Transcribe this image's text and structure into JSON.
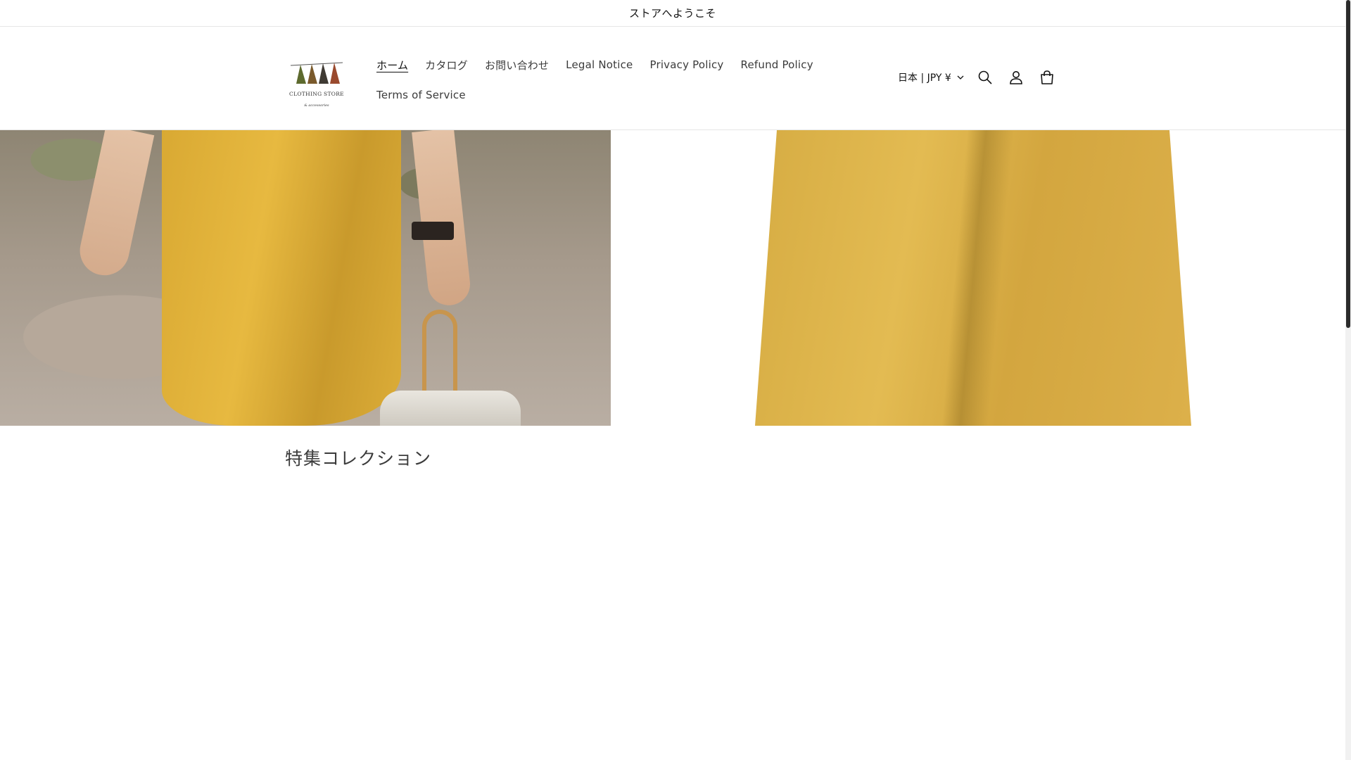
{
  "announcement": {
    "text": "ストアへようこそ"
  },
  "header": {
    "logo": {
      "text": "CLOTHING STORE",
      "sub": "& accessories"
    },
    "nav": [
      {
        "label": "ホーム",
        "active": true
      },
      {
        "label": "カタログ",
        "active": false
      },
      {
        "label": "お問い合わせ",
        "active": false
      },
      {
        "label": "Legal Notice",
        "active": false
      },
      {
        "label": "Privacy Policy",
        "active": false
      },
      {
        "label": "Refund Policy",
        "active": false
      },
      {
        "label": "Terms of Service",
        "active": false
      }
    ],
    "locale": "日本 | JPY ¥",
    "icons": [
      "search-icon",
      "account-icon",
      "cart-icon"
    ]
  },
  "featured": {
    "title": "特集コレクション"
  },
  "colors": {
    "text": "#121212",
    "nav_text": "#3b3b3b",
    "border": "#e6e6e6",
    "hero_dress": "#e0b23d"
  }
}
